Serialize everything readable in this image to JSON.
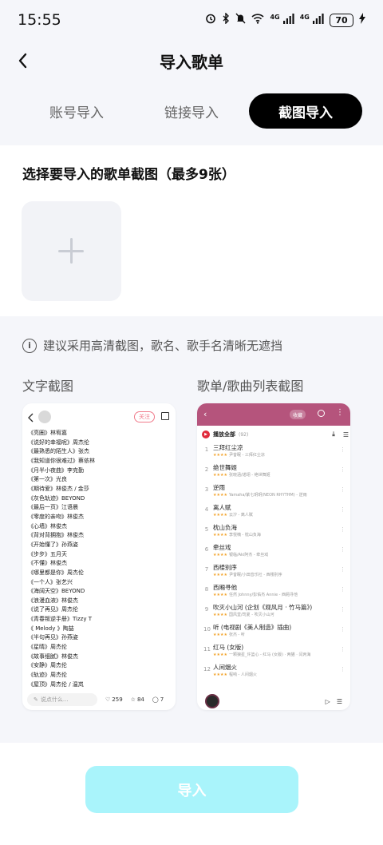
{
  "status_bar": {
    "time": "15:55",
    "signal_1": "4G",
    "signal_2": "4G",
    "battery": "70"
  },
  "header": {
    "title": "导入歌单"
  },
  "tabs": [
    {
      "label": "账号导入",
      "active": false
    },
    {
      "label": "链接导入",
      "active": false
    },
    {
      "label": "截图导入",
      "active": true
    }
  ],
  "upload": {
    "title": "选择要导入的歌单截图（最多9张）"
  },
  "tip": {
    "text": "建议采用高清截图，歌名、歌手名清晰无遮挡"
  },
  "examples": {
    "text_label": "文字截图",
    "list_label": "歌单/歌曲列表截图"
  },
  "example_text": {
    "follow": "关注",
    "lines": [
      "《亮圈》林宥嘉",
      "《说好的幸福呢》周杰伦",
      "《最熟悉的陌生人》张杰",
      "《我知道你很难过》蔡依林",
      "《月半小夜曲》李克勤",
      "《第一次》光良",
      "《期待爱》林俊杰 / 金莎",
      "《灰色轨迹》BEYOND",
      "《最后一页》江语晨",
      "《零度的亲吻》林俊杰",
      "《心墙》林俊杰",
      "《背对背拥抱》林俊杰",
      "《开始懂了》孙燕姿",
      "《步步》五月天",
      "《不懂》林俊杰",
      "《哪里都是你》周杰伦",
      "《一个人》张艺兴",
      "《海阔天空》BEYOND",
      "《浪漫血液》林俊杰",
      "《说了再见》周杰伦",
      "《青春叛逆手册》Tizzy T",
      "《 Melody 》陶喆",
      "《半句再见》孙燕姿",
      "《星晴》周杰伦",
      "《故事细腻》林俊杰",
      "《安静》周杰伦",
      "《轨迹》周杰伦",
      "《屋顶》周杰伦 / 温岚"
    ],
    "input_placeholder": "说点什么...",
    "likes": "259",
    "stars": "84",
    "comments": "7"
  },
  "example_list": {
    "collect": "收藏",
    "play_all": "播放全部",
    "count": "(92)",
    "songs": [
      {
        "num": "1",
        "title": "三拜红尘凉",
        "sub": "尹昔眠 - 三拜红尘凉"
      },
      {
        "num": "2",
        "title": "绝世舞姬",
        "sub": "张晓涵/诺翊 - 绝世舞姬"
      },
      {
        "num": "3",
        "title": "逆雨",
        "sub": "Yamaha/紫七玥玥(NEON RHYTHM) - 逆雨"
      },
      {
        "num": "4",
        "title": "离人赋",
        "sub": "云汐 - 离人赋"
      },
      {
        "num": "5",
        "title": "枕山负海",
        "sub": "李悦楠 - 枕山负海"
      },
      {
        "num": "6",
        "title": "牵丝戏",
        "sub": "银临/Aki阿杰 - 牵丝戏"
      },
      {
        "num": "7",
        "title": "西楼别序",
        "sub": "尹昔眠/小田音乐社 - 西楼别序"
      },
      {
        "num": "8",
        "title": "西厢寻他",
        "sub": "任然 Johnny/彭佑杰 Annie - 西厢寻他"
      },
      {
        "num": "9",
        "title": "吹灭小山河 (企划《观风月 · 竹马篇》)",
        "sub": "国风堂/司夏 - 吹灭小山河"
      },
      {
        "num": "10",
        "title": "听 (电视剧《美人制造》插曲)",
        "sub": "张杰 - 听"
      },
      {
        "num": "11",
        "title": "红马 (女版)",
        "sub": "一颗狼星_许篮心 - 红马 (女版) · 两猫 · 闫丙海"
      },
      {
        "num": "12",
        "title": "人间烟火",
        "sub": "程响 - 人间烟火"
      }
    ]
  },
  "bottom": {
    "import_label": "导入"
  },
  "colors": {
    "accent_black": "#000000",
    "import_button": "#a9f4fb",
    "playlist_header": "#b5547c"
  }
}
